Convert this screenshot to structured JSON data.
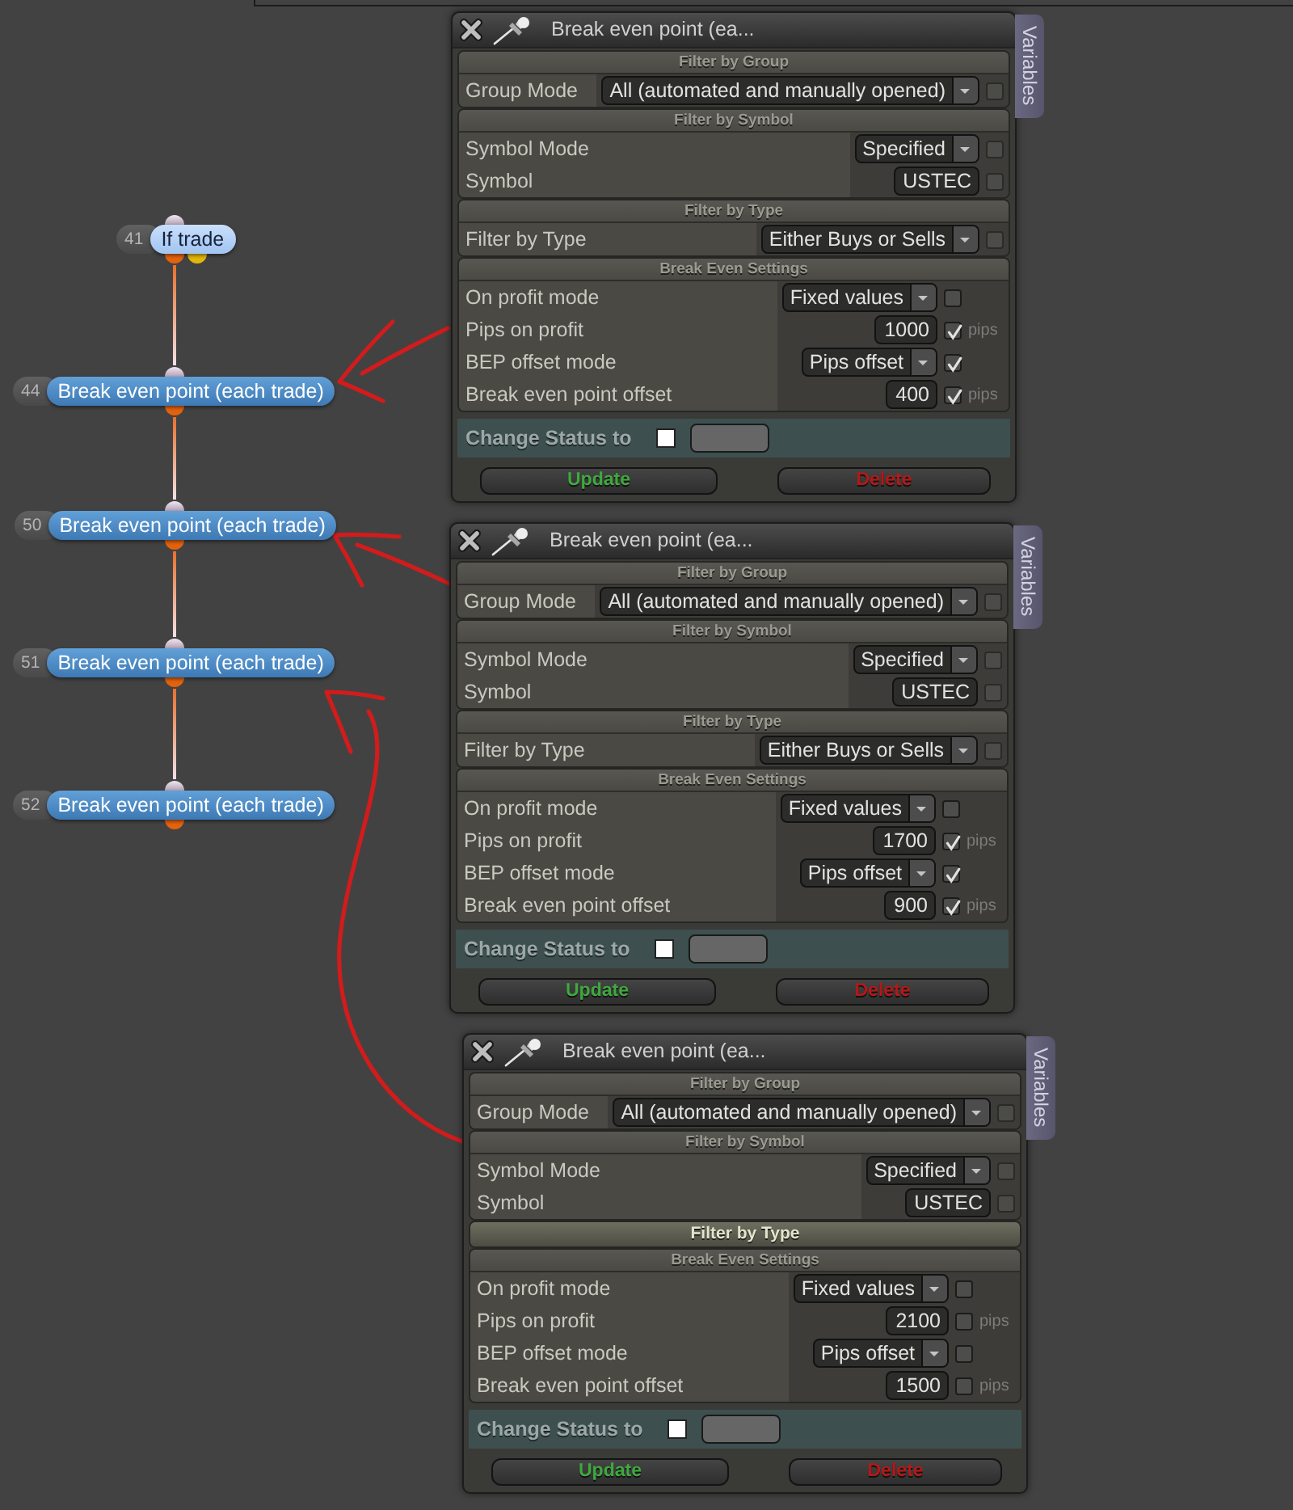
{
  "canvas": {
    "nodes": [
      {
        "number": "41",
        "label": "If trade",
        "kind": "condition"
      },
      {
        "number": "44",
        "label": "Break even point (each trade)",
        "kind": "action"
      },
      {
        "number": "50",
        "label": "Break even point (each trade)",
        "kind": "action"
      },
      {
        "number": "51",
        "label": "Break even point (each trade)",
        "kind": "action"
      },
      {
        "number": "52",
        "label": "Break even point (each trade)",
        "kind": "action"
      }
    ]
  },
  "panels": [
    {
      "title": "Break even point (ea...",
      "side_tab": "Variables",
      "sections": [
        {
          "title": "Filter by Group",
          "expanded": true,
          "rows": [
            {
              "label": "Group Mode",
              "kind": "dropdown",
              "value": "All (automated and manually opened)",
              "checkbox": {
                "checked": false,
                "disabled": true
              }
            }
          ]
        },
        {
          "title": "Filter by Symbol",
          "expanded": true,
          "rows": [
            {
              "label": "Symbol Mode",
              "kind": "dropdown",
              "value": "Specified",
              "checkbox": {
                "checked": false,
                "disabled": true
              }
            },
            {
              "label": "Symbol",
              "kind": "input",
              "value": "USTEC",
              "checkbox": {
                "checked": false,
                "disabled": true
              }
            }
          ]
        },
        {
          "title": "Filter by Type",
          "expanded": true,
          "rows": [
            {
              "label": "Filter by Type",
              "kind": "dropdown",
              "value": "Either Buys or Sells",
              "checkbox": {
                "checked": false,
                "disabled": true
              }
            }
          ]
        },
        {
          "title": "Break Even Settings",
          "expanded": true,
          "rows": [
            {
              "label": "On profit mode",
              "kind": "dropdown",
              "value": "Fixed values",
              "checkbox": {
                "checked": false,
                "disabled": false
              }
            },
            {
              "label": "Pips on profit",
              "kind": "input",
              "value": "1000",
              "checkbox": {
                "checked": true,
                "disabled": false
              },
              "unit": "pips"
            },
            {
              "label": "BEP offset mode",
              "kind": "dropdown",
              "value": "Pips offset",
              "checkbox": {
                "checked": true,
                "disabled": false
              }
            },
            {
              "label": "Break even point offset",
              "kind": "input",
              "value": "400",
              "checkbox": {
                "checked": true,
                "disabled": false
              },
              "unit": "pips"
            }
          ]
        }
      ],
      "status": {
        "label": "Change Status to",
        "checked": false
      },
      "buttons": [
        {
          "label": "Update",
          "kind": "update"
        },
        {
          "label": "Delete",
          "kind": "delete"
        }
      ]
    },
    {
      "title": "Break even point (ea...",
      "side_tab": "Variables",
      "sections": [
        {
          "title": "Filter by Group",
          "expanded": true,
          "rows": [
            {
              "label": "Group Mode",
              "kind": "dropdown",
              "value": "All (automated and manually opened)",
              "checkbox": {
                "checked": false,
                "disabled": true
              }
            }
          ]
        },
        {
          "title": "Filter by Symbol",
          "expanded": true,
          "rows": [
            {
              "label": "Symbol Mode",
              "kind": "dropdown",
              "value": "Specified",
              "checkbox": {
                "checked": false,
                "disabled": true
              }
            },
            {
              "label": "Symbol",
              "kind": "input",
              "value": "USTEC",
              "checkbox": {
                "checked": false,
                "disabled": true
              }
            }
          ]
        },
        {
          "title": "Filter by Type",
          "expanded": true,
          "rows": [
            {
              "label": "Filter by Type",
              "kind": "dropdown",
              "value": "Either Buys or Sells",
              "checkbox": {
                "checked": false,
                "disabled": true
              }
            }
          ]
        },
        {
          "title": "Break Even Settings",
          "expanded": true,
          "rows": [
            {
              "label": "On profit mode",
              "kind": "dropdown",
              "value": "Fixed values",
              "checkbox": {
                "checked": false,
                "disabled": false
              }
            },
            {
              "label": "Pips on profit",
              "kind": "input",
              "value": "1700",
              "checkbox": {
                "checked": true,
                "disabled": false
              },
              "unit": "pips"
            },
            {
              "label": "BEP offset mode",
              "kind": "dropdown",
              "value": "Pips offset",
              "checkbox": {
                "checked": true,
                "disabled": false
              }
            },
            {
              "label": "Break even point offset",
              "kind": "input",
              "value": "900",
              "checkbox": {
                "checked": true,
                "disabled": false
              },
              "unit": "pips"
            }
          ]
        }
      ],
      "status": {
        "label": "Change Status to",
        "checked": false
      },
      "buttons": [
        {
          "label": "Update",
          "kind": "update"
        },
        {
          "label": "Delete",
          "kind": "delete"
        }
      ]
    },
    {
      "title": "Break even point (ea...",
      "side_tab": "Variables",
      "sections": [
        {
          "title": "Filter by Group",
          "expanded": true,
          "rows": [
            {
              "label": "Group Mode",
              "kind": "dropdown",
              "value": "All (automated and manually opened)",
              "checkbox": {
                "checked": false,
                "disabled": true
              }
            }
          ]
        },
        {
          "title": "Filter by Symbol",
          "expanded": true,
          "rows": [
            {
              "label": "Symbol Mode",
              "kind": "dropdown",
              "value": "Specified",
              "checkbox": {
                "checked": false,
                "disabled": true
              }
            },
            {
              "label": "Symbol",
              "kind": "input",
              "value": "USTEC",
              "checkbox": {
                "checked": false,
                "disabled": true
              }
            }
          ]
        },
        {
          "title": "Filter by Type",
          "expanded": false
        },
        {
          "title": "Break Even Settings",
          "expanded": true,
          "rows": [
            {
              "label": "On profit mode",
              "kind": "dropdown",
              "value": "Fixed values",
              "checkbox": {
                "checked": false,
                "disabled": false
              }
            },
            {
              "label": "Pips on profit",
              "kind": "input",
              "value": "2100",
              "checkbox": {
                "checked": false,
                "disabled": false
              },
              "unit": "pips"
            },
            {
              "label": "BEP offset mode",
              "kind": "dropdown",
              "value": "Pips offset",
              "checkbox": {
                "checked": false,
                "disabled": false
              }
            },
            {
              "label": "Break even point offset",
              "kind": "input",
              "value": "1500",
              "checkbox": {
                "checked": false,
                "disabled": false
              },
              "unit": "pips"
            }
          ]
        }
      ],
      "status": {
        "label": "Change Status to",
        "checked": false
      },
      "buttons": [
        {
          "label": "Update",
          "kind": "update"
        },
        {
          "label": "Delete",
          "kind": "delete"
        }
      ]
    }
  ]
}
